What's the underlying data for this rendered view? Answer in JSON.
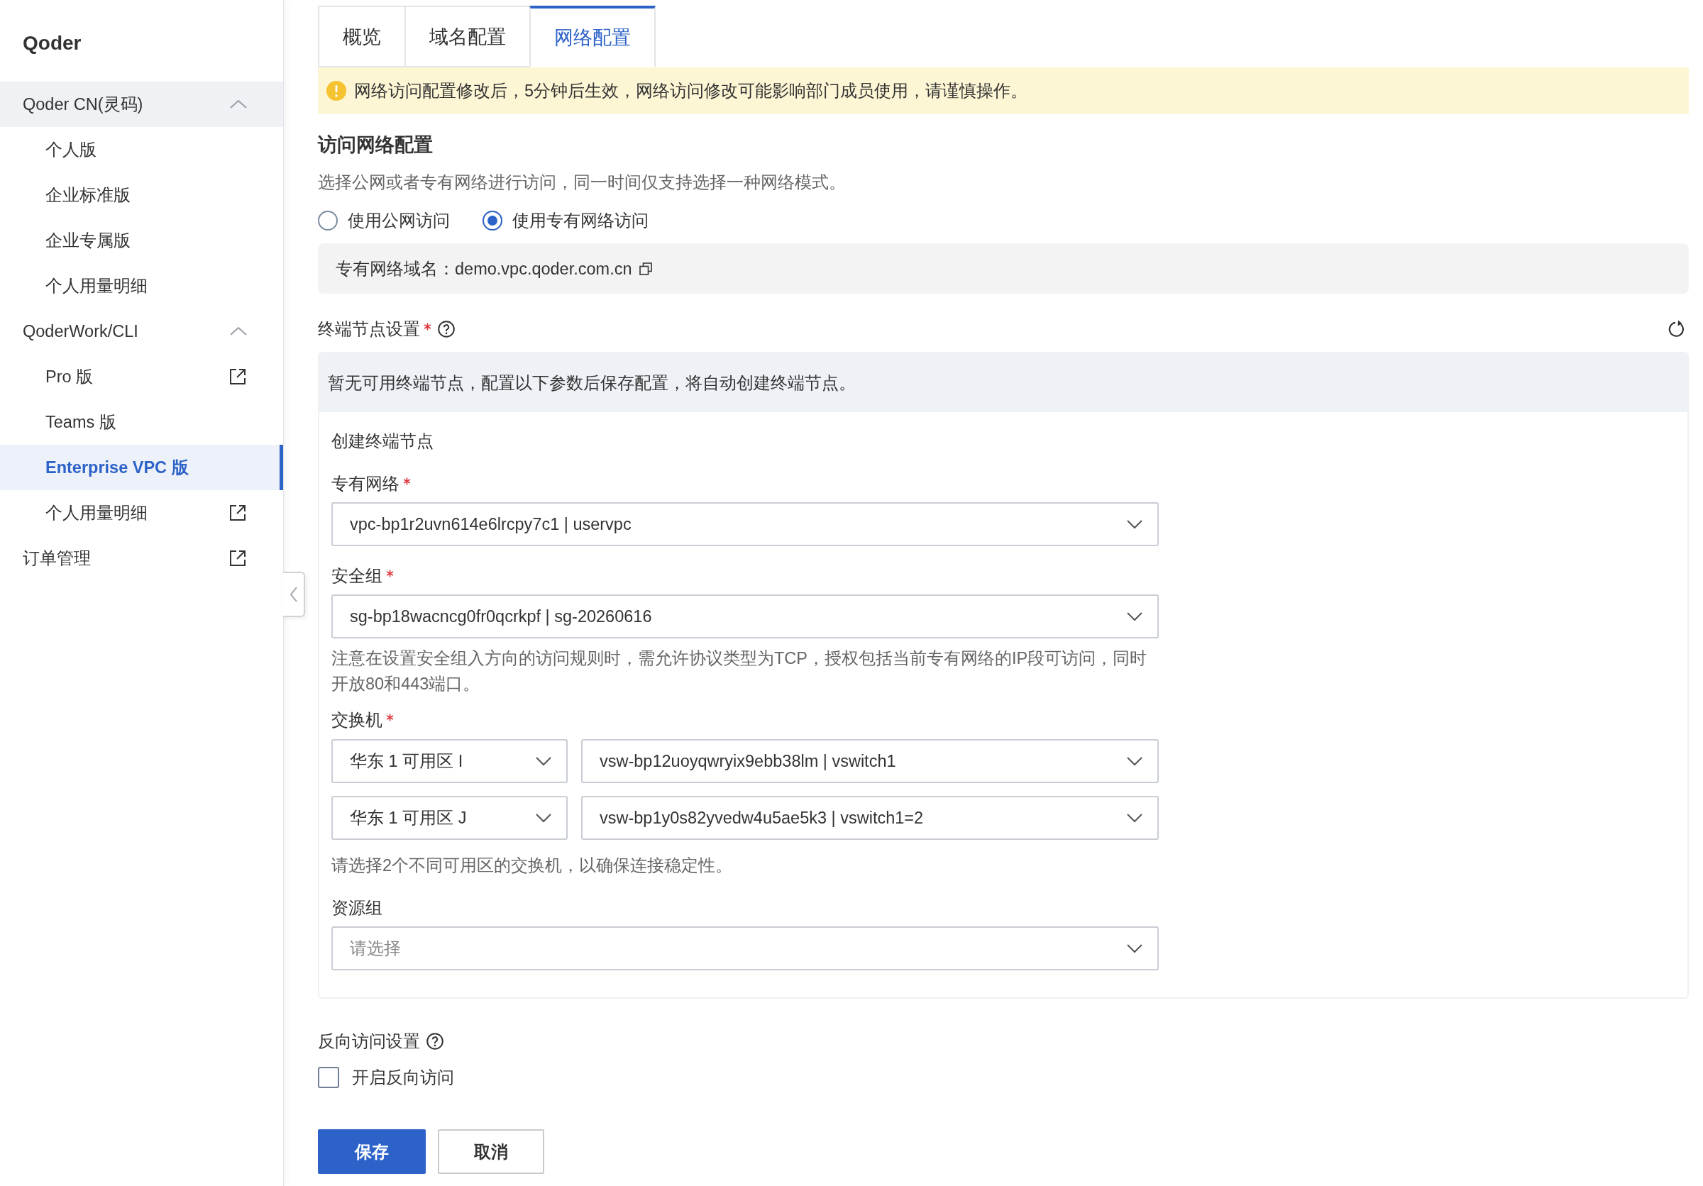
{
  "sidebar": {
    "title": "Qoder",
    "items": [
      {
        "kind": "group",
        "label": "Qoder CN(灵码)",
        "expanded": true,
        "hovered": true,
        "children": [
          {
            "label": "个人版",
            "selected": false,
            "external": false
          },
          {
            "label": "企业标准版",
            "selected": false,
            "external": false
          },
          {
            "label": "企业专属版",
            "selected": false,
            "external": false
          },
          {
            "label": "个人用量明细",
            "selected": false,
            "external": false
          }
        ]
      },
      {
        "kind": "group",
        "label": "QoderWork/CLI",
        "expanded": true,
        "hovered": false,
        "children": [
          {
            "label": "Pro 版",
            "selected": false,
            "external": true
          },
          {
            "label": "Teams 版",
            "selected": false,
            "external": false
          },
          {
            "label": "Enterprise VPC 版",
            "selected": true,
            "external": false
          },
          {
            "label": "个人用量明细",
            "selected": false,
            "external": true
          }
        ]
      },
      {
        "kind": "link",
        "label": "订单管理",
        "selected": false,
        "external": true
      }
    ]
  },
  "tabs": [
    {
      "label": "概览",
      "selected": false
    },
    {
      "label": "域名配置",
      "selected": false
    },
    {
      "label": "网络配置",
      "selected": true
    }
  ],
  "notice": {
    "text": "网络访问配置修改后，5分钟后生效，网络访问修改可能影响部门成员使用，请谨慎操作。"
  },
  "access": {
    "title": "访问网络配置",
    "description": "选择公网或者专有网络进行访问，同一时间仅支持选择一种网络模式。",
    "modes": [
      {
        "label": "使用公网访问",
        "selected": false
      },
      {
        "label": "使用专有网络访问",
        "selected": true
      }
    ],
    "domain_text": "专有网络域名：demo.vpc.qoder.com.cn"
  },
  "endpoint": {
    "title": "终端节点设置",
    "required": true,
    "empty_notice": "暂无可用终端节点，配置以下参数后保存配置，将自动创建终端节点。",
    "create_title": "创建终端节点",
    "fields": [
      {
        "kind": "select",
        "label": "专有网络",
        "required": true,
        "value": "vpc-bp1r2uvn614e6lrcpy7c1 | uservpc"
      },
      {
        "kind": "select",
        "label": "安全组",
        "required": true,
        "value": "sg-bp18wacncg0fr0qcrkpf | sg-20260616",
        "help": "注意在设置安全组入方向的访问规则时，需允许协议类型为TCP，授权包括当前专有网络的IP段可访问，同时开放80和443端口。"
      },
      {
        "kind": "switch_pairs",
        "label": "交换机",
        "required": true,
        "rows": [
          {
            "zone": "华东 1 可用区 I",
            "vswitch": "vsw-bp12uoyqwryix9ebb38lm | vswitch1"
          },
          {
            "zone": "华东 1 可用区 J",
            "vswitch": "vsw-bp1y0s82yvedw4u5ae5k3 | vswitch1=2"
          }
        ],
        "help": "请选择2个不同可用区的交换机，以确保连接稳定性。"
      },
      {
        "kind": "select",
        "label": "资源组",
        "required": false,
        "placeholder": "请选择"
      }
    ]
  },
  "reverse": {
    "title": "反向访问设置",
    "option": {
      "label": "开启反向访问",
      "checked": false
    }
  },
  "buttons": [
    {
      "label": "保存",
      "kind": "primary"
    },
    {
      "label": "取消",
      "kind": "secondary"
    }
  ]
}
